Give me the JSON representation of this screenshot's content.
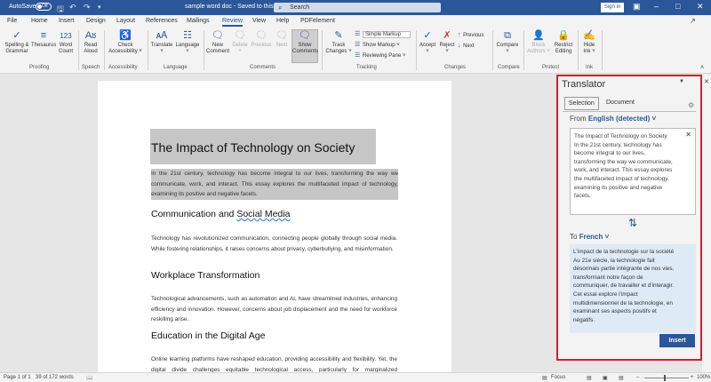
{
  "titlebar": {
    "autosave_label": "AutoSave",
    "autosave_state": "Off",
    "doc_title": "sample word doc  -  Saved to this PC  ˅",
    "search_placeholder": "Search",
    "signin_label": "Sign in",
    "icons": [
      "save-icon",
      "undo-icon",
      "redo-icon",
      "customize-icon"
    ]
  },
  "menu": {
    "items": [
      "File",
      "Home",
      "Insert",
      "Design",
      "Layout",
      "References",
      "Mailings",
      "Review",
      "View",
      "Help",
      "PDFelement"
    ],
    "active": "Review"
  },
  "ribbon": {
    "proofing": {
      "spelling": "Spelling &\nGrammar",
      "thesaurus": "Thesaurus",
      "word_count": "Word\nCount",
      "group": "Proofing"
    },
    "speech": {
      "read_aloud": "Read\nAloud",
      "group": "Speech"
    },
    "accessibility": {
      "check": "Check\nAccessibility ˅",
      "group": "Accessibility"
    },
    "language": {
      "translate": "Translate\n˅",
      "language": "Language\n˅",
      "group": "Language"
    },
    "comments": {
      "new": "New\nComment",
      "delete": "Delete\n˅",
      "previous": "Previous",
      "next": "Next",
      "show": "Show\nComments",
      "group": "Comments"
    },
    "tracking": {
      "track": "Track\nChanges ˅",
      "simple_markup": "Simple Markup",
      "show_markup": "Show Markup ˅",
      "reviewing_pane": "Reviewing Pane ˅",
      "group": "Tracking"
    },
    "changes": {
      "accept": "Accept\n˅",
      "reject": "Reject\n˅",
      "previous": "Previous",
      "next": "Next",
      "group": "Changes"
    },
    "compare": {
      "compare": "Compare\n˅",
      "group": "Compare"
    },
    "protect": {
      "block": "Block\nAuthors ˅",
      "restrict": "Restrict\nEditing",
      "group": "Protect"
    },
    "ink": {
      "hide": "Hide\nInk ˅",
      "group": "Ink"
    }
  },
  "document": {
    "title": "The Impact of Technology on Society",
    "intro": "In the 21st century, technology has become integral to our lives, transforming the way we communicate, work, and interact. This essay explores the multifaceted impact of technology, examining its positive and negative facets.",
    "h1_prefix": "Communication and ",
    "h1_suffix": "Social Media",
    "p1": "Technology has revolutionized communication, connecting people globally through social media. While fostering relationships, it raises concerns about privacy, cyberbullying, and misinformation.",
    "h2": "Workplace Transformation",
    "p2": "Technological advancements, such as automation and AI, have streamlined industries, enhancing efficiency and innovation. However, concerns about job displacement and the need for workforce reskilling arise.",
    "h3": "Education in the Digital Age",
    "p3": "Online learning platforms have reshaped education, providing accessibility and flexibility. Yet, the digital divide challenges equitable technological access, particularly for marginalized communities."
  },
  "translator": {
    "title": "Translator",
    "tabs": [
      "Selection",
      "Document"
    ],
    "active_tab": "Selection",
    "from_label": "From",
    "from_lang": "English (detected) ˅",
    "source_lines": [
      "The Impact of Technology on Society",
      "In the 21st century, technology has",
      "become integral to our lives,",
      "transforming the way we communicate,",
      "work, and interact. This essay explores",
      "the multifaceted impact of technology,",
      "examining its positive and negative",
      "facets."
    ],
    "to_label": "To",
    "to_lang": "French ˅",
    "target_lines": [
      "L'impact de la technologie sur la société",
      "Au 21e siècle, la technologie fait",
      "désormais partie intégrante de nos vies,",
      "transformant notre façon de",
      "communiquer, de travailler et d'interagir.",
      "Cet essai explore l'impact",
      "multidimensionnel de la technologie, en",
      "examinant ses aspects positifs et",
      "négatifs."
    ],
    "insert_label": "Insert"
  },
  "status": {
    "page": "Page 1 of 1",
    "words": "39 of 172 words",
    "focus": "Focus",
    "zoom": "100%"
  },
  "colors": {
    "accent": "#2b579a",
    "highlight_frame": "#d0202a",
    "selection_bg": "#c6c6c6",
    "target_bg": "#deebf7"
  }
}
